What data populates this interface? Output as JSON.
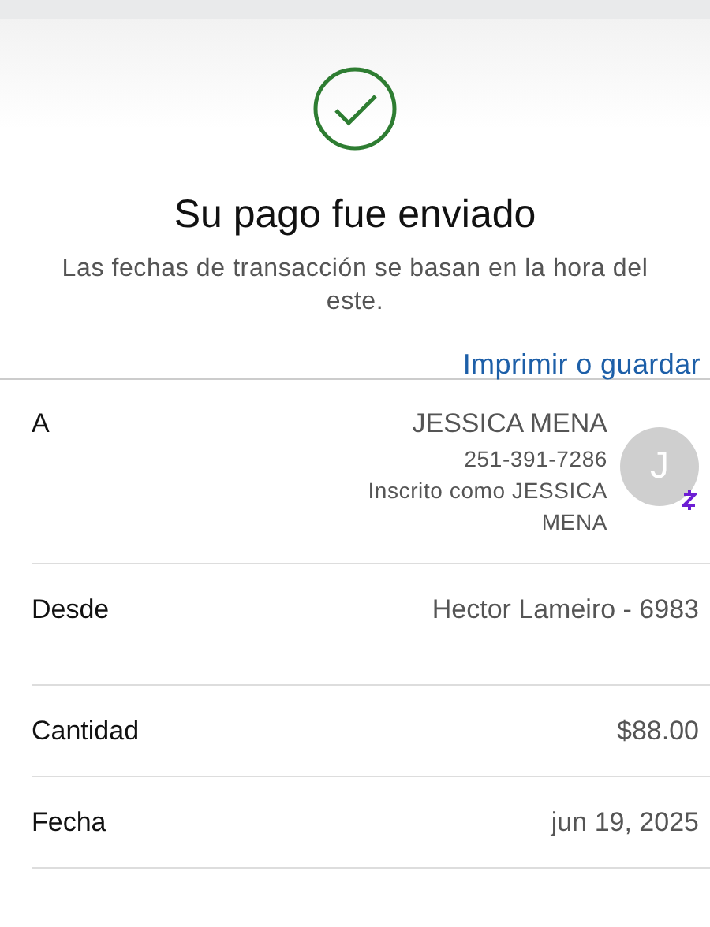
{
  "status": {
    "title": "Su pago fue enviado",
    "note": "Las fechas de transacción se basan en la hora del este.",
    "action": "Imprimir o guardar"
  },
  "rows": [
    {
      "kind": "recipient",
      "label": "A",
      "name": "JESSICA MENA",
      "phone": "251-391-7286",
      "enrolled": "Inscrito como JESSICA MENA",
      "avatar_initial": "J"
    },
    {
      "kind": "simple",
      "label": "Desde",
      "value": "Hector Lameiro - 6983"
    },
    {
      "kind": "simple",
      "label": "Cantidad",
      "value": "$88.00"
    },
    {
      "kind": "simple",
      "label": "Fecha",
      "value": "jun 19, 2025"
    }
  ]
}
